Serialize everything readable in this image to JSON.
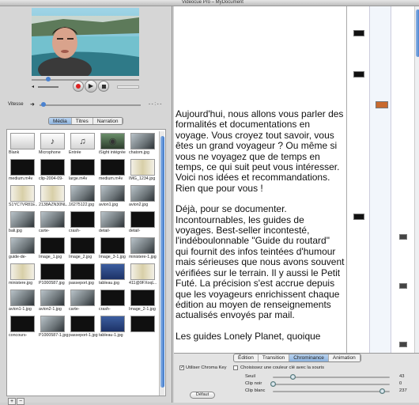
{
  "window": {
    "title": "Videocue Pro – MyDocument"
  },
  "player": {
    "time_left": "",
    "time_right": ""
  },
  "speed": {
    "label": "Vitesse",
    "readout": "- - : - -"
  },
  "library": {
    "tabs": [
      "Média",
      "Titres",
      "Narration"
    ],
    "selected_tab": "Média",
    "items": [
      {
        "label": "Blank",
        "kind": "blank"
      },
      {
        "label": "Microphone",
        "kind": "mic"
      },
      {
        "label": "Entrée",
        "kind": "input"
      },
      {
        "label": "iSight intégrée",
        "kind": "isight"
      },
      {
        "label": "chatom.jpg",
        "kind": "img"
      },
      {
        "label": "medium.m4v",
        "kind": "dark"
      },
      {
        "label": "clip-2004-09-",
        "kind": "dark"
      },
      {
        "label": "large.m4v",
        "kind": "dark"
      },
      {
        "label": "medium.m4v",
        "kind": "dark"
      },
      {
        "label": "IMG_1234.jpg",
        "kind": "doc"
      },
      {
        "label": "S1YC7VR81E..",
        "kind": "doc"
      },
      {
        "label": "2138AZN30NL..",
        "kind": "doc"
      },
      {
        "label": "16275122.jpg",
        "kind": "img"
      },
      {
        "label": "avion1.jpg",
        "kind": "img"
      },
      {
        "label": "avion2.jpg",
        "kind": "img"
      },
      {
        "label": "bali.jpg",
        "kind": "img"
      },
      {
        "label": "carte-",
        "kind": "img"
      },
      {
        "label": "crash-",
        "kind": "dark"
      },
      {
        "label": "detail-",
        "kind": "img"
      },
      {
        "label": "detail-",
        "kind": "dark"
      },
      {
        "label": "guide-de-",
        "kind": "img"
      },
      {
        "label": "Image_1.jpg",
        "kind": "dark"
      },
      {
        "label": "Image_2.jpg",
        "kind": "dark"
      },
      {
        "label": "Image_3-1.jpg",
        "kind": "dark"
      },
      {
        "label": "ministere-1.jpg",
        "kind": "img"
      },
      {
        "label": "ministere.jpg",
        "kind": "doc"
      },
      {
        "label": "P1000587.jpg",
        "kind": "dark"
      },
      {
        "label": "passeport.jpg",
        "kind": "dark"
      },
      {
        "label": "tableau.jpg",
        "kind": "blue"
      },
      {
        "label": "411@9FXoqL..",
        "kind": "doc"
      },
      {
        "label": "avion1-1.jpg",
        "kind": "img"
      },
      {
        "label": "avion2-1.jpg",
        "kind": "img"
      },
      {
        "label": "carte-",
        "kind": "img"
      },
      {
        "label": "crash-",
        "kind": "dark"
      },
      {
        "label": "Image_2-1.jpg",
        "kind": "dark"
      },
      {
        "label": "concours-",
        "kind": "dark"
      },
      {
        "label": "P1000587-1.jpg",
        "kind": "img"
      },
      {
        "label": "passeport-1.jpg",
        "kind": "dark"
      },
      {
        "label": "tableau-1.jpg",
        "kind": "blue"
      },
      {
        "label": "",
        "kind": "dark"
      }
    ],
    "add_label": "+",
    "remove_label": "−"
  },
  "document": {
    "paragraphs": [
      "Aujourd'hui, nous allons vous parler des formalités et documentations en voyage. Vous croyez tout savoir, vous êtes un grand voyageur ? Ou même si vous ne voyagez que de temps en temps, ce qui suit peut vous intéresser. Voici nos idées et recommandations. Rien que pour vous !",
      "Déjà, pour se documenter. Incontournables, les guides de voyages. Best-seller incontesté, l'indéboulonnable \"Guide du routard\" qui fournit des infos teintées d'humour mais sérieuses que nous avons souvent vérifiées sur le terrain. Il y aussi le Petit Futé. La précision s'est accrue depuis que les voyageurs enrichissent chaque édition au moyen de renseignements actualisés envoyés par mail.",
      "Les guides Lonely Planet, quoique"
    ]
  },
  "panel": {
    "tabs": [
      "Édition",
      "Transition",
      "Chrominance",
      "Animation"
    ],
    "selected_tab": "Chrominance",
    "use_chroma_label": "Utiliser Chroma Key",
    "use_chroma_checked": true,
    "pick_color_label": "Choisissez une couleur clé avec la souris",
    "pick_color_checked": false,
    "sliders": [
      {
        "label": "Seuil",
        "value": 43,
        "max": 255
      },
      {
        "label": "Clip noir",
        "value": 0,
        "max": 255
      },
      {
        "label": "Clip blanc",
        "value": 237,
        "max": 255
      }
    ],
    "default_button": "Défaut"
  },
  "colors": {
    "accent": "#3c78c9",
    "tab_selected": "#9fbfe5"
  }
}
